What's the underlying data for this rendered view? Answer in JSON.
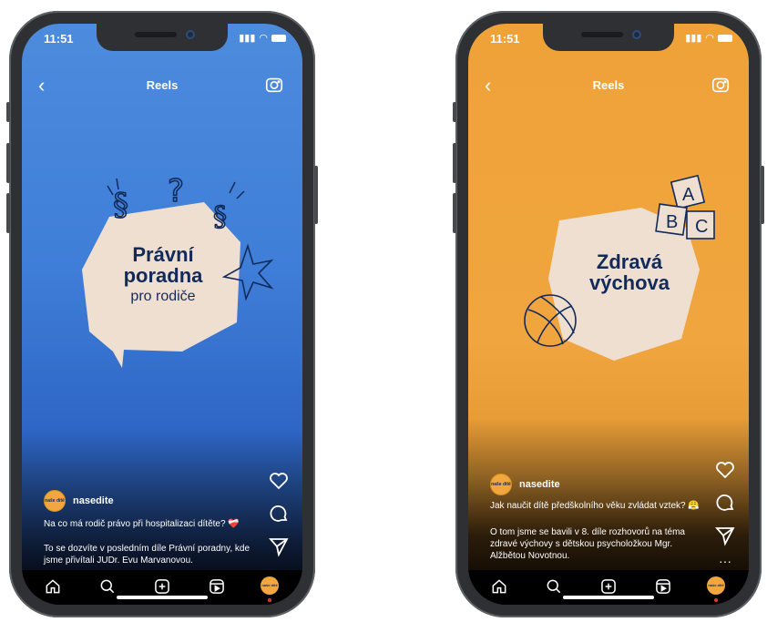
{
  "phones": [
    {
      "status": {
        "time": "11:51"
      },
      "header": {
        "title": "Reels"
      },
      "card": {
        "line1": "Právní",
        "line2": "poradna",
        "line3": "pro rodiče"
      },
      "post": {
        "username": "nasedite",
        "avatar_text": "naše dítě",
        "caption": "Na co má rodič právo při hospitalizaci dítěte? ❤️‍🩹",
        "description": "To se dozvíte v posledním díle Právní poradny, kde jsme přivítali JUDr. Evu Marvanovou."
      },
      "actions": [
        "heart-icon",
        "comment-icon",
        "share-icon",
        "more-icon"
      ]
    },
    {
      "status": {
        "time": "11:51"
      },
      "header": {
        "title": "Reels"
      },
      "card": {
        "line1": "Zdravá",
        "line2": "výchova",
        "blocks": [
          "A",
          "B",
          "C"
        ]
      },
      "post": {
        "username": "nasedite",
        "avatar_text": "naše dítě",
        "caption": "Jak naučit dítě předškolního věku zvládat vztek? 😤",
        "description": "O tom jsme se bavili v 8. díle rozhovorů na téma zdravé výchovy s dětskou psycholožkou Mgr. Alžbětou Novotnou."
      },
      "actions": [
        "heart-icon",
        "comment-icon",
        "share-icon",
        "more-icon"
      ]
    }
  ],
  "nav": [
    "home-icon",
    "search-icon",
    "create-icon",
    "reels-icon",
    "profile-avatar"
  ],
  "colors": {
    "blue_bg": "#3f7ed8",
    "orange_bg": "#f1a53e",
    "card_bg": "#efdfd1",
    "navy": "#122a5a"
  }
}
